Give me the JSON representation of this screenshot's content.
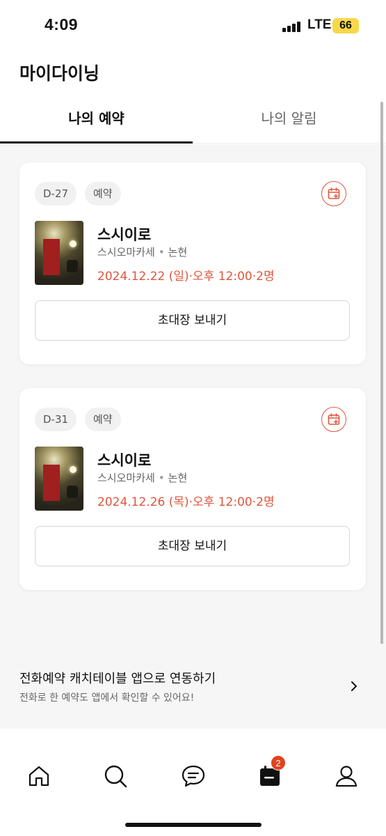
{
  "status_bar": {
    "time": "4:09",
    "network": "LTE",
    "battery": "66"
  },
  "page": {
    "title": "마이다이닝"
  },
  "tabs": [
    {
      "label": "나의 예약",
      "active": true
    },
    {
      "label": "나의 알림",
      "active": false
    }
  ],
  "reservations": [
    {
      "dday": "D-27",
      "kind": "예약",
      "name": "스시이로",
      "category": "스시오마카세",
      "area": "논현",
      "datetime": "2024.12.22 (일)·오후 12:00·2명",
      "invite_label": "초대장 보내기",
      "calendar_icon": "calendar-add-icon"
    },
    {
      "dday": "D-31",
      "kind": "예약",
      "name": "스시이로",
      "category": "스시오마카세",
      "area": "논현",
      "datetime": "2024.12.26 (목)·오후 12:00·2명",
      "invite_label": "초대장 보내기",
      "calendar_icon": "calendar-add-icon"
    }
  ],
  "link_banner": {
    "title": "전화예약 캐치테이블 앱으로 연동하기",
    "subtitle": "전화로 한 예약도 앱에서 확인할 수 있어요!"
  },
  "bottom_nav": {
    "items": [
      "home-icon",
      "search-icon",
      "chat-icon",
      "calendar-icon",
      "profile-icon"
    ],
    "calendar_badge": "2"
  },
  "colors": {
    "accent": "#e0553a",
    "badge": "#e2431e",
    "battery": "#f7d84a"
  }
}
